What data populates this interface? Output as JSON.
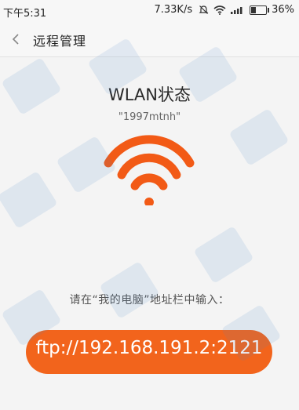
{
  "status_bar": {
    "time": "下午5:31",
    "net_speed": "7.33K/s",
    "battery": "36%",
    "icons": [
      "muted-icon",
      "wifi-icon",
      "signal-icon",
      "battery-icon"
    ]
  },
  "header": {
    "title": "远程管理",
    "back_icon": "chevron-left-icon"
  },
  "main": {
    "wlan_title": "WLAN状态",
    "ssid": "\"1997mtnh\"",
    "wifi_icon": "wifi-icon",
    "instruction": "请在“我的电脑”地址栏中输入：",
    "ftp_address": "ftp://192.168.191.2:2121"
  },
  "colors": {
    "accent": "#f2641c",
    "wifi": "#f25a16"
  }
}
